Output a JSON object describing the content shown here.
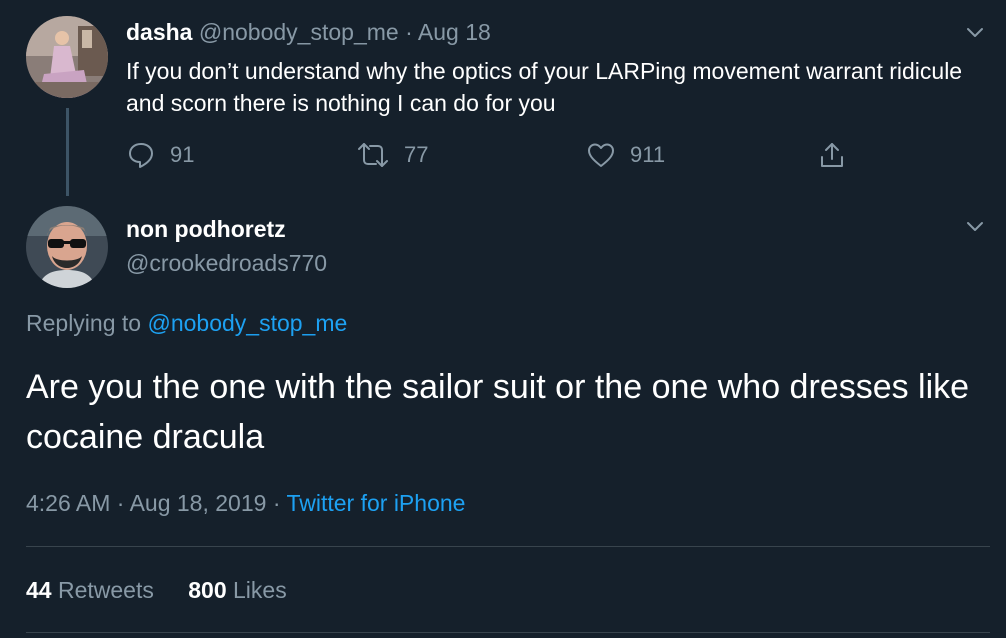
{
  "parent_tweet": {
    "name": "dasha",
    "handle": "@nobody_stop_me",
    "separator": "·",
    "date": "Aug 18",
    "text": "If you don’t understand why the optics of your LARPing movement warrant ridicule and scorn there is nothing I can do for you",
    "actions": {
      "reply_count": "91",
      "retweet_count": "77",
      "like_count": "911"
    }
  },
  "main_tweet": {
    "name": "non podhoretz",
    "handle": "@crookedroads770",
    "replying_prefix": "Replying to",
    "replying_to": "@nobody_stop_me",
    "text": "Are you the one with the sailor suit or the one who dresses like cocaine dracula",
    "time": "4:26 AM",
    "separator": "·",
    "date": "Aug 18, 2019",
    "source": "Twitter for iPhone",
    "stats": {
      "retweets_count": "44",
      "retweets_label": "Retweets",
      "likes_count": "800",
      "likes_label": "Likes"
    }
  },
  "colors": {
    "background": "#15202b",
    "text": "#ffffff",
    "muted": "#8899a6",
    "link": "#1da1f2",
    "divider": "#38444d"
  },
  "icons": [
    "reply-icon",
    "retweet-icon",
    "like-icon",
    "share-icon",
    "chevron-down-icon"
  ]
}
